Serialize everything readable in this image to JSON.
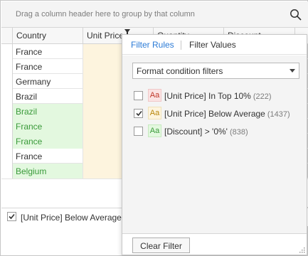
{
  "group_panel": {
    "hint": "Drag a column header here to group by that column"
  },
  "columns": [
    "Country",
    "Unit Price",
    "Quantity",
    "Discount"
  ],
  "rows": [
    {
      "country": "France",
      "highlighted": false
    },
    {
      "country": "France",
      "highlighted": false
    },
    {
      "country": "Germany",
      "highlighted": false
    },
    {
      "country": "Brazil",
      "highlighted": false
    },
    {
      "country": "Brazil",
      "highlighted": true
    },
    {
      "country": "France",
      "highlighted": true
    },
    {
      "country": "France",
      "highlighted": true
    },
    {
      "country": "France",
      "highlighted": false
    },
    {
      "country": "Belgium",
      "highlighted": true
    }
  ],
  "filter_bar": {
    "checked": true,
    "text": "[Unit Price] Below Average"
  },
  "popup": {
    "tabs": {
      "active": "Filter Rules",
      "inactive": "Filter Values"
    },
    "combo": {
      "value": "Format condition filters"
    },
    "rules": [
      {
        "format": "Aa",
        "format_style": "red",
        "label": "[Unit Price] In Top 10%",
        "count": "(222)",
        "checked": false
      },
      {
        "format": "Aa",
        "format_style": "yellow",
        "label": "[Unit Price] Below Average",
        "count": "(1437)",
        "checked": true
      },
      {
        "format": "Aa",
        "format_style": "green",
        "label": "[Discount] > '0%'",
        "count": "(838)",
        "checked": false
      }
    ],
    "clear_button": "Clear Filter"
  },
  "colors": {
    "accent": "#2a7ad6",
    "highlight_green": "#e3f8df",
    "highlight_yellow": "#fdf4de",
    "highlight_red": "#fbe3e3"
  },
  "icons": [
    "search-icon",
    "filter-funnel-icon",
    "chevron-down-icon",
    "checkmark-icon",
    "size-grip-icon"
  ]
}
